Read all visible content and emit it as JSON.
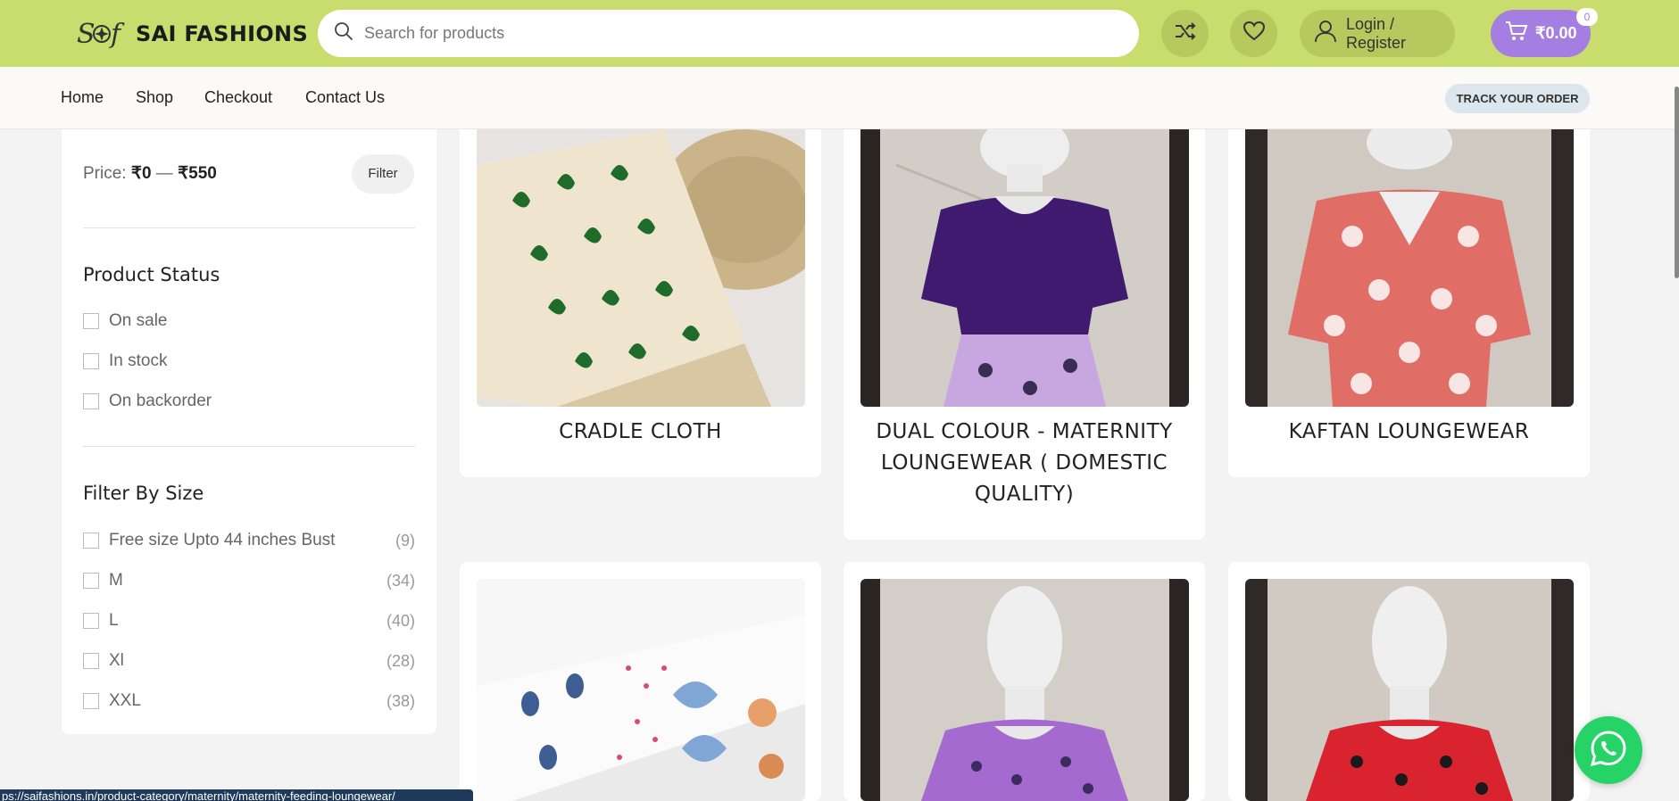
{
  "brand": {
    "name": "SAI FASHIONS",
    "mark": "SF"
  },
  "search": {
    "placeholder": "Search for products"
  },
  "header": {
    "login_label": "Login / Register",
    "cart_total": "₹0.00",
    "cart_count": "0",
    "accent_green": "#c8dd6e",
    "accent_purple": "#a47ee0"
  },
  "nav": {
    "items": [
      {
        "label": "Home"
      },
      {
        "label": "Shop"
      },
      {
        "label": "Checkout"
      },
      {
        "label": "Contact Us"
      }
    ],
    "track_label": "TRACK YOUR ORDER"
  },
  "sidebar": {
    "price_prefix": "Price:",
    "price_min": "₹0",
    "price_sep": "—",
    "price_max": "₹550",
    "filter_label": "Filter",
    "status_title": "Product Status",
    "status_options": [
      {
        "label": "On sale"
      },
      {
        "label": "In stock"
      },
      {
        "label": "On backorder"
      }
    ],
    "size_title": "Filter By Size",
    "size_options": [
      {
        "label": "Free size Upto 44 inches Bust",
        "count": "(9)"
      },
      {
        "label": "M",
        "count": "(34)"
      },
      {
        "label": "L",
        "count": "(40)"
      },
      {
        "label": "Xl",
        "count": "(28)"
      },
      {
        "label": "XXL",
        "count": "(38)"
      }
    ]
  },
  "products": [
    {
      "title": "CRADLE CLOTH",
      "image": "dinosaur-print-fabric"
    },
    {
      "title": "DUAL COLOUR - MATERNITY LOUNGEWEAR ( DOMESTIC QUALITY)",
      "image": "purple-dual-colour-dress"
    },
    {
      "title": "KAFTAN LOUNGEWEAR",
      "image": "floral-coral-kaftan"
    },
    {
      "title": "",
      "image": "printed-baby-cloths"
    },
    {
      "title": "",
      "image": "purple-printed-dress"
    },
    {
      "title": "",
      "image": "red-cartoon-print-dress"
    }
  ],
  "status_url": "ps://saifashions.in/product-category/maternity/maternity-feeding-loungewear/"
}
